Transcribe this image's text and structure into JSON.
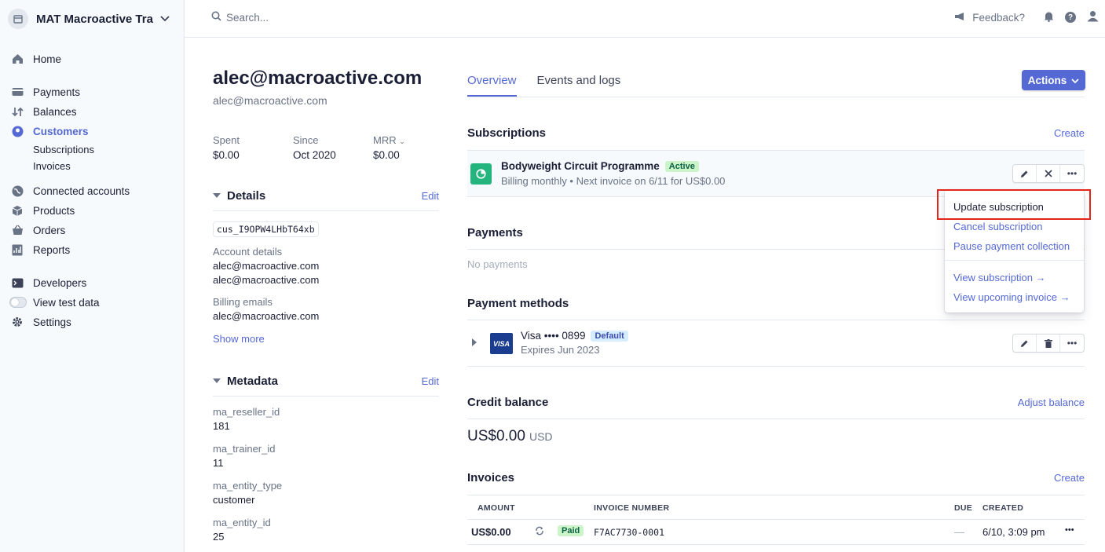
{
  "account": {
    "name": "MAT Macroactive Trai..."
  },
  "sidebar": {
    "home": "Home",
    "payments": "Payments",
    "balances": "Balances",
    "customers": "Customers",
    "subscriptions": "Subscriptions",
    "invoices": "Invoices",
    "connected_accounts": "Connected accounts",
    "products": "Products",
    "orders": "Orders",
    "reports": "Reports",
    "developers": "Developers",
    "view_test_data": "View test data",
    "settings": "Settings"
  },
  "topbar": {
    "search_placeholder": "Search...",
    "feedback": "Feedback?"
  },
  "customer": {
    "title": "alec@macroactive.com",
    "subtitle": "alec@macroactive.com",
    "stats": [
      {
        "label": "Spent",
        "value": "$0.00"
      },
      {
        "label": "Since",
        "value": "Oct 2020"
      },
      {
        "label": "MRR",
        "value": "$0.00"
      }
    ],
    "details": {
      "title": "Details",
      "edit": "Edit",
      "id": "cus_I9OPW4LHbT64xb",
      "account_details_label": "Account details",
      "account_details_1": "alec@macroactive.com",
      "account_details_2": "alec@macroactive.com",
      "billing_emails_label": "Billing emails",
      "billing_emails": "alec@macroactive.com",
      "show_more": "Show more"
    },
    "metadata": {
      "title": "Metadata",
      "edit": "Edit",
      "items": [
        {
          "key": "ma_reseller_id",
          "value": "181"
        },
        {
          "key": "ma_trainer_id",
          "value": "11"
        },
        {
          "key": "ma_entity_type",
          "value": "customer"
        },
        {
          "key": "ma_entity_id",
          "value": "25"
        }
      ]
    }
  },
  "tabs": {
    "overview": "Overview",
    "events": "Events and logs"
  },
  "actions_label": "Actions",
  "subscriptions": {
    "title": "Subscriptions",
    "create": "Create",
    "name": "Bodyweight Circuit Programme",
    "status": "Active",
    "meta": "Billing monthly • Next invoice on 6/11 for US$0.00"
  },
  "payments": {
    "title": "Payments",
    "empty": "No payments"
  },
  "payment_methods": {
    "title": "Payment methods",
    "brand_logo": "VISA",
    "card": "Visa •••• 0899",
    "badge": "Default",
    "expires": "Expires Jun 2023"
  },
  "credit_balance": {
    "title": "Credit balance",
    "action": "Adjust balance",
    "amount": "US$0.00",
    "currency": "USD"
  },
  "invoices": {
    "title": "Invoices",
    "create": "Create",
    "columns": {
      "amount": "AMOUNT",
      "number": "INVOICE NUMBER",
      "due": "DUE",
      "created": "CREATED"
    },
    "row": {
      "amount": "US$0.00",
      "status": "Paid",
      "number": "F7AC7730-0001",
      "due": "—",
      "created": "6/10, 3:09 pm"
    }
  },
  "menu": {
    "update": "Update subscription",
    "cancel": "Cancel subscription",
    "pause": "Pause payment collection",
    "view_subscription": "View subscription →",
    "view_invoice": "View upcoming invoice →"
  },
  "colors": {
    "accent": "#5469d4",
    "highlight": "#e5241a",
    "success": "#24b47e"
  }
}
